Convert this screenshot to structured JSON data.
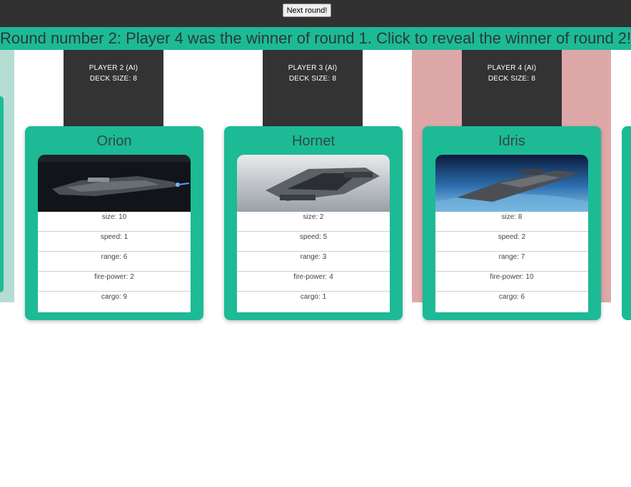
{
  "toolbar": {
    "next_round_label": "Next round!"
  },
  "banner": {
    "text": "Round number 2: Player 4 was the winner of round 1. Click to reveal the winner of round 2!"
  },
  "players": [
    {
      "label": "PLAYER 2 (AI)",
      "deck": "DECK SIZE: 8",
      "card": {
        "name": "Orion",
        "stats": [
          "size: 10",
          "speed: 1",
          "range: 6",
          "fire-power: 2",
          "cargo: 9"
        ]
      }
    },
    {
      "label": "PLAYER 3 (AI)",
      "deck": "DECK SIZE: 8",
      "card": {
        "name": "Hornet",
        "stats": [
          "size: 2",
          "speed: 5",
          "range: 3",
          "fire-power: 4",
          "cargo: 1"
        ]
      }
    },
    {
      "label": "PLAYER 4 (AI)",
      "deck": "DECK SIZE: 8",
      "card": {
        "name": "Idris",
        "stats": [
          "size: 8",
          "speed: 2",
          "range: 7",
          "fire-power: 10",
          "cargo: 6"
        ]
      }
    }
  ],
  "colors": {
    "accent": "#1dba96",
    "winner_highlight": "#dea8a8",
    "left_highlight": "#b4dcd3",
    "dark": "#333333"
  }
}
